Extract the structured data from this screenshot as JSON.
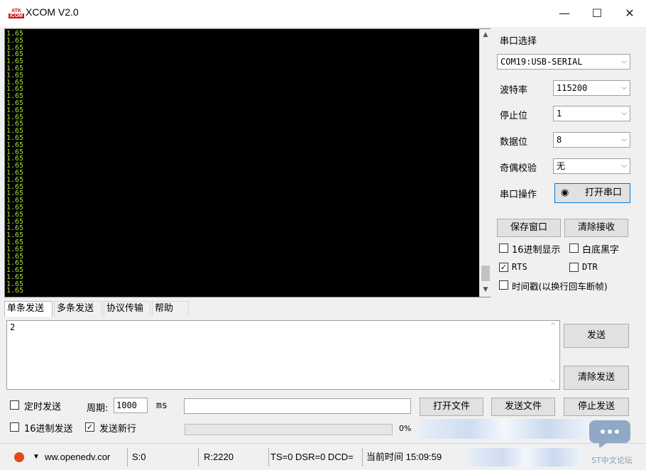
{
  "window": {
    "logo_top": "ATK",
    "logo_bottom": "ICOM",
    "title": "XCOM V2.0",
    "controls": {
      "minimize": "—",
      "maximize": "☐",
      "close": "✕"
    }
  },
  "receive": {
    "lines": [
      "1.65",
      "1.65",
      "1.65",
      "1.65",
      "1.65",
      "1.65",
      "1.65",
      "1.65",
      "1.65",
      "1.65",
      "1.65",
      "1.65",
      "1.65",
      "1.65",
      "1.65",
      "1.65",
      "1.65",
      "1.65",
      "1.65",
      "1.65",
      "1.65",
      "1.65",
      "1.65",
      "1.65",
      "1.65",
      "1.65",
      "1.65",
      "1.65",
      "1.65",
      "1.65",
      "1.65",
      "1.65",
      "1.65",
      "1.65",
      "1.65",
      "1.65",
      "1.65",
      "1.65"
    ]
  },
  "settings": {
    "port_label": "串口选择",
    "port_value": "COM19:USB-SERIAL",
    "baud_label": "波特率",
    "baud_value": "115200",
    "stop_label": "停止位",
    "stop_value": "1",
    "data_label": "数据位",
    "data_value": "8",
    "parity_label": "奇偶校验",
    "parity_value": "无",
    "op_label": "串口操作",
    "open_port": "打开串口",
    "save_window": "保存窗口",
    "clear_receive": "清除接收",
    "hex_display": "16进制显示",
    "white_bg": "白底黑字",
    "rts": "RTS",
    "rts_checked": true,
    "dtr": "DTR",
    "timestamp": "时间戳(以换行回车断帧)"
  },
  "tabs": [
    "单条发送",
    "多条发送",
    "协议传输",
    "帮助"
  ],
  "send": {
    "text": "2",
    "send_button": "发送",
    "clear_send": "清除发送",
    "timed_send": "定时发送",
    "period_label": "周期:",
    "period_value": "1000",
    "period_unit": "ms",
    "open_file": "打开文件",
    "send_file": "发送文件",
    "stop_send": "停止发送",
    "hex_send": "16进制发送",
    "send_newline": "发送新行",
    "send_newline_checked": true,
    "progress_text": "0%",
    "progress": 0
  },
  "status": {
    "url": "ww.openedv.cor",
    "sent": "S:0",
    "received": "R:2220",
    "signals": "TS=0 DSR=0 DCD=",
    "time": "当前时间 15:09:59"
  },
  "watermark": "ST中文论坛"
}
